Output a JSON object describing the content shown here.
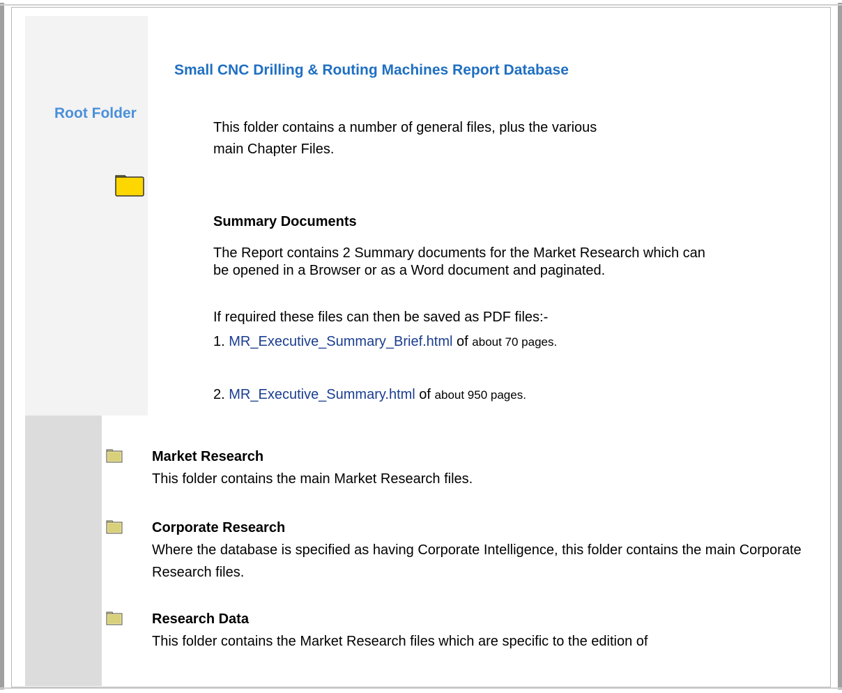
{
  "sidebar": {
    "title": "Root Folder",
    "icon": "folder-icon"
  },
  "header": {
    "title": "Small CNC Drilling & Routing Machines Report Database"
  },
  "intro": {
    "text": "This folder contains a number of general files, plus the various main Chapter Files."
  },
  "summary": {
    "heading": "Summary Documents",
    "description": "The Report contains 2 Summary documents for the Market Research which can be opened in a Browser or as a Word document and paginated.",
    "pdf_note": "If required these files can then be saved as PDF files:-",
    "documents": [
      {
        "number": "1.",
        "link": "MR_Executive_Summary_Brief.html",
        "of": "of",
        "pages": "about 70 pages."
      },
      {
        "number": "2.",
        "link": "MR_Executive_Summary.html",
        "of": "of",
        "pages": "about 950 pages."
      }
    ]
  },
  "folders": [
    {
      "name": "Market Research",
      "description": "This folder contains the main Market Research files.",
      "icon": "folder-icon"
    },
    {
      "name": "Corporate Research",
      "description": "Where the database is specified as having Corporate Intelligence, this folder contains the main Corporate Research files.",
      "icon": "folder-icon"
    },
    {
      "name": "Research Data",
      "description": "This folder contains the Market Research files which are specific to the edition of",
      "icon": "folder-icon"
    }
  ],
  "colors": {
    "title_blue": "#1f6fc2",
    "sidebar_blue": "#4a90d9",
    "link_blue": "#1a3d8f",
    "folder_yellow": "#ffd700"
  }
}
